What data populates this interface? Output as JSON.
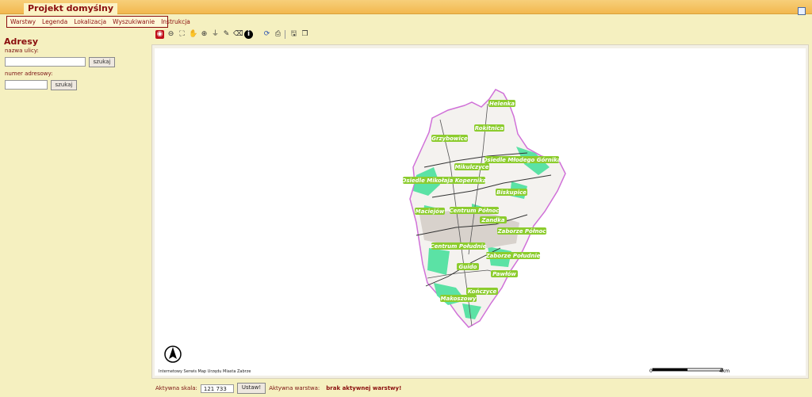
{
  "header": {
    "title": "Projekt domyślny"
  },
  "menu": [
    {
      "label": "Warstwy"
    },
    {
      "label": "Legenda"
    },
    {
      "label": "Lokalizacja"
    },
    {
      "label": "Wyszukiwanie"
    },
    {
      "label": "Instrukcja"
    }
  ],
  "sidebar": {
    "title": "Adresy",
    "street_label": "nazwa ulicy:",
    "street_value": "",
    "street_button": "szukaj",
    "number_label": "numer adresowy:",
    "number_value": "",
    "number_button": "szukaj"
  },
  "toolbar": {
    "tools": [
      "map-settings-icon",
      "zoom-out-icon",
      "full-extent-icon",
      "pan-hand-icon",
      "zoom-in-icon",
      "measure-icon",
      "select-icon",
      "clear-icon",
      "info-icon",
      "refresh-icon",
      "print-icon",
      "export-icon",
      "layer-icon"
    ]
  },
  "map": {
    "districts": [
      "Helenka",
      "Rokitnica",
      "Grzybowice",
      "Osiedle Młodego Górnika",
      "Mikulczyce",
      "Osiedle Mikołaja Kopernika",
      "Biskupice",
      "Maciejów",
      "Centrum Północ",
      "Zandka",
      "Zaborze Północ",
      "Centrum Południe",
      "Zaborze Południe",
      "Guido",
      "Pawłów",
      "Kończyce",
      "Makoszowy"
    ],
    "copyright": "Internetowy Serwis Map Urzędu Miasta Zabrze",
    "scale_bar": {
      "start": "0",
      "end": "4km"
    },
    "colors": {
      "green_area": "#5be2a5",
      "boundary": "#d070d8",
      "label_bg": "#8ccc2e"
    }
  },
  "status": {
    "scale_label": "Aktywna skala:",
    "scale_value": "121 733",
    "set_button": "Ustaw!",
    "layer_label": "Aktywna warstwa:",
    "layer_value": "brak aktywnej warstwy!"
  }
}
